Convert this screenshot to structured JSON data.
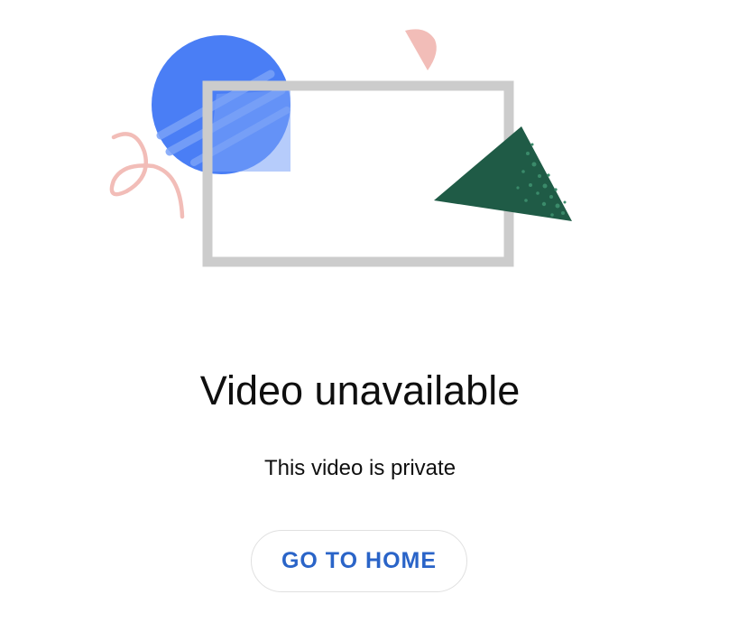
{
  "error": {
    "title": "Video unavailable",
    "message": "This video is private"
  },
  "actions": {
    "home_label": "GO TO HOME"
  },
  "illustration": {
    "shapes": [
      "blue-circle-shape",
      "tv-frame-shape",
      "pink-squiggle-shape",
      "pink-half-circle-shape",
      "green-triangle-shape"
    ],
    "colors": {
      "blue": "#4a7ef5",
      "blue_light": "#7aa2f8",
      "frame": "#cccccc",
      "pink": "#f2bdb8",
      "green": "#1f5b46",
      "green_speckle": "#3a8a6a"
    }
  },
  "colors": {
    "accent": "#2a64c8",
    "text": "#0f0f0f",
    "button_border": "#e0e0e0"
  }
}
